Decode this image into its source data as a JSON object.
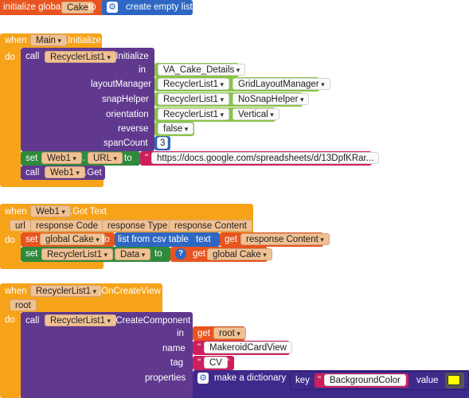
{
  "init_global": {
    "prefix": "initialize global",
    "var_name": "Cake",
    "to": "to",
    "create_empty_list": "create empty list"
  },
  "main_init": {
    "when": "when",
    "component": "Main",
    "event": ".Initialize",
    "do": "do",
    "call": "call",
    "recycler": "RecyclerList1",
    "method": ".Initialize",
    "param_in": "in",
    "in_value": "VA_Cake_Details",
    "param_layoutManager": "layoutManager",
    "layout_comp": "RecyclerList1",
    "layout_value": "GridLayoutManager",
    "param_snapHelper": "snapHelper",
    "snap_comp": "RecyclerList1",
    "snap_value": "NoSnapHelper",
    "param_orientation": "orientation",
    "orient_comp": "RecyclerList1",
    "orient_value": "Vertical",
    "param_reverse": "reverse",
    "reverse_value": "false",
    "param_spanCount": "spanCount",
    "span_value": "3",
    "set": "set",
    "web": "Web1",
    "url_prop": "URL",
    "to": "to",
    "url_value": "https://docs.google.com/spreadsheets/d/13DpfKRar...",
    "call2": "call",
    "web2": "Web1",
    "get": ".Get"
  },
  "got_text": {
    "when": "when",
    "component": "Web1",
    "event": ".Got Text",
    "params": [
      "url",
      "response Code",
      "response Type",
      "response Content"
    ],
    "do": "do",
    "set": "set",
    "var": "global Cake",
    "to": "to",
    "list_from_csv": "list from csv table",
    "text": "text",
    "get": "get",
    "get_var": "response Content",
    "set2": "set",
    "recycler": "RecyclerList1",
    "data_prop": "Data",
    "to2": "to",
    "get2": "get",
    "get_var2": "global Cake"
  },
  "create_view": {
    "when": "when",
    "component": "RecyclerList1",
    "event": ".OnCreateView",
    "param_root": "root",
    "do": "do",
    "call": "call",
    "recycler": "RecyclerList1",
    "method": ".CreateComponent",
    "param_in": "in",
    "get": "get",
    "in_value": "root",
    "param_name": "name",
    "name_value": "MakeroidCardView",
    "param_tag": "tag",
    "tag_value": "CV",
    "param_properties": "properties",
    "make_dict": "make a dictionary",
    "key": "key",
    "key_value": "BackgroundColor",
    "value": "value"
  },
  "colors": {
    "orange": "#e8541f",
    "amber": "#f7a31a",
    "purple": "#60398f",
    "green": "#56a13c",
    "pink": "#cd1f5d",
    "blue": "#2d67c2",
    "swatch": "#ffff00"
  }
}
